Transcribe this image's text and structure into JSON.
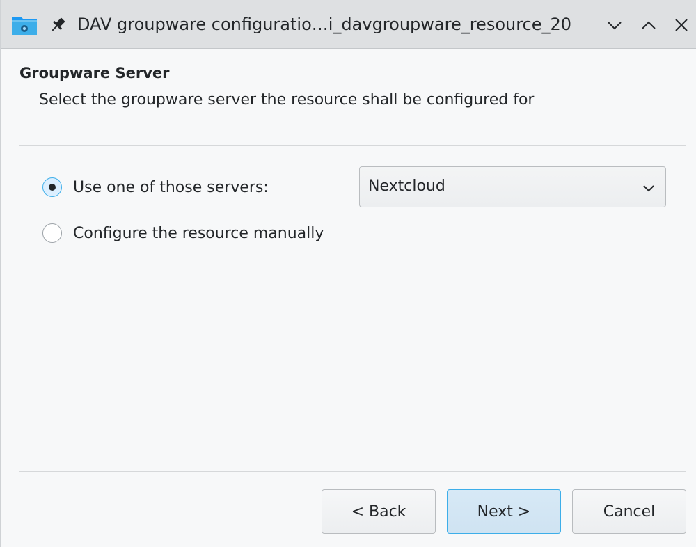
{
  "titlebar": {
    "title": "DAV groupware configuratio…i_davgroupware_resource_20",
    "app_icon": "folder-icon",
    "pin_icon": "pin-icon",
    "buttons": [
      "minimize-chevron-down-icon",
      "maximize-chevron-up-icon",
      "close-icon"
    ]
  },
  "page": {
    "heading": "Groupware Server",
    "subheading": "Select the groupware server the resource shall be configured for"
  },
  "options": {
    "use_server_label": "Use one of those servers:",
    "use_server_checked": true,
    "manual_label": "Configure the resource manually",
    "manual_checked": false
  },
  "server_combo": {
    "selected": "Nextcloud"
  },
  "buttons": {
    "back": "< Back",
    "next": "Next >",
    "cancel": "Cancel"
  },
  "colors": {
    "accent": "#3daee9",
    "text": "#232629",
    "titlebar_bg": "#dee0e2",
    "window_bg": "#f7f8f9"
  }
}
